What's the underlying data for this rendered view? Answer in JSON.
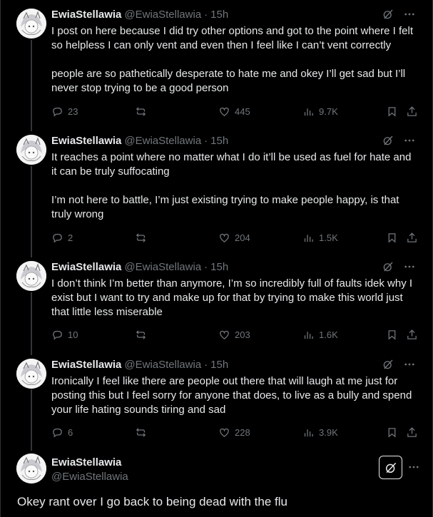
{
  "tweets": [
    {
      "name": "EwiaStellawia",
      "handle": "@EwiaStellawia",
      "time": "15h",
      "paragraphs": [
        "I post on here because I did try other options and got to the point where I felt so helpless I can only vent and even then I feel like I can’t vent correctly",
        "people are so pathetically desperate to hate me and okey I’ll get sad but I’ll never stop trying to be a good person"
      ],
      "replies": "23",
      "reposts": "",
      "likes": "445",
      "views": "9.7K"
    },
    {
      "name": "EwiaStellawia",
      "handle": "@EwiaStellawia",
      "time": "15h",
      "paragraphs": [
        "It reaches a point where no matter what I do it’ll be used as fuel for hate and it can be truly suffocating",
        "I’m not here to battle, I’m just existing trying to make people happy, is that truly wrong"
      ],
      "replies": "2",
      "reposts": "",
      "likes": "204",
      "views": "1.5K"
    },
    {
      "name": "EwiaStellawia",
      "handle": "@EwiaStellawia",
      "time": "15h",
      "paragraphs": [
        "I don’t think I’m better than anymore, I’m so incredibly full of faults idek why I exist but I want to try and make up for that by trying to make this world just that little less miserable"
      ],
      "replies": "10",
      "reposts": "",
      "likes": "203",
      "views": "1.6K"
    },
    {
      "name": "EwiaStellawia",
      "handle": "@EwiaStellawia",
      "time": "15h",
      "paragraphs": [
        "Ironically I feel like there are people out there that will laugh at me just for posting this but I feel sorry for anyone that does, to live as a bully and spend your life hating sounds tiring and sad"
      ],
      "replies": "6",
      "reposts": "",
      "likes": "228",
      "views": "3.9K"
    }
  ],
  "main_post": {
    "name": "EwiaStellawia",
    "handle": "@EwiaStellawia",
    "text": "Okey rant over I go back to being dead with the flu"
  },
  "icons": {
    "grok": "grok-icon",
    "more": "more-icon",
    "reply": "reply-icon",
    "repost": "repost-icon",
    "like": "like-icon",
    "views": "views-icon",
    "bookmark": "bookmark-icon",
    "share": "share-icon"
  },
  "colors": {
    "background": "#000000",
    "text": "#e7e9ea",
    "muted": "#71767b",
    "divider": "#2f3336"
  }
}
